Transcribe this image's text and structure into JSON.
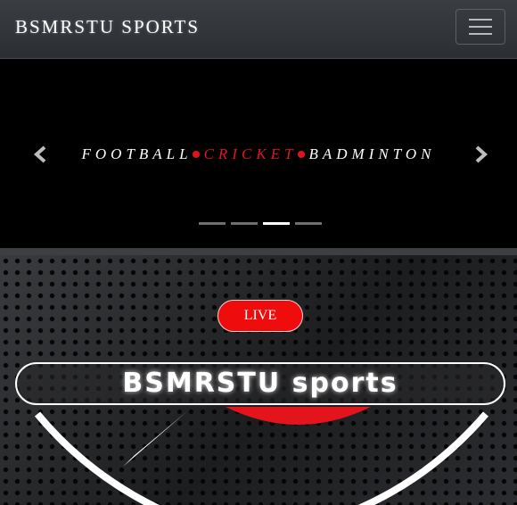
{
  "navbar": {
    "brand": "BSMRSTU SPORTS",
    "toggle_icon": "hamburger-menu-icon"
  },
  "carousel": {
    "caption_parts": [
      "FOOTBALL",
      "CRICKET",
      "BADMINTON"
    ],
    "highlight_color": "#e0141e",
    "slide_count": 4,
    "active_slide": 3,
    "prev_icon": "chevron-left-icon",
    "next_icon": "chevron-right-icon"
  },
  "hero": {
    "live_label": "LIVE",
    "live_color": "#ee0c0c",
    "title": "BSMRSTU sports"
  }
}
